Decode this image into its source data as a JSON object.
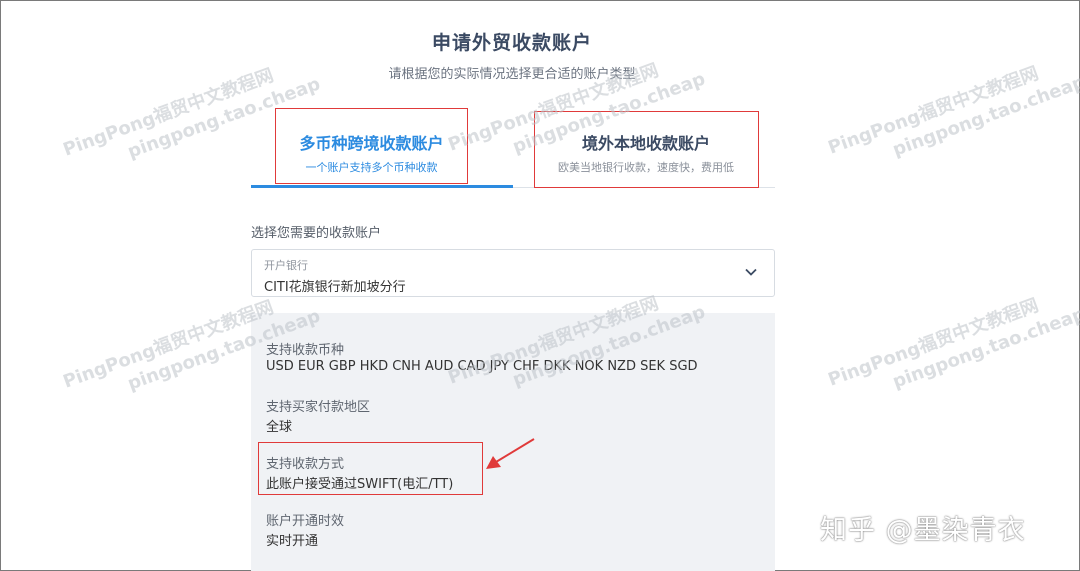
{
  "header": {
    "title": "申请外贸收款账户",
    "subtitle": "请根据您的实际情况选择更合适的账户类型"
  },
  "tabs": [
    {
      "title": "多币种跨境收款账户",
      "desc": "一个账户支持多个币种收款",
      "active": true
    },
    {
      "title": "境外本地收款账户",
      "desc": "欧美当地银行收款，速度快，费用低",
      "active": false
    }
  ],
  "form": {
    "section_label": "选择您需要的收款账户",
    "bank_select": {
      "label": "开户银行",
      "value": "CITI花旗银行新加坡分行",
      "icon": "chevron-down-icon"
    }
  },
  "details": [
    {
      "label": "支持收款币种",
      "value": "USD EUR GBP HKD CNH AUD CAD JPY CHF DKK NOK NZD SEK SGD"
    },
    {
      "label": "支持买家付款地区",
      "value": "全球"
    },
    {
      "label": "支持收款方式",
      "value": "此账户接受通过SWIFT(电汇/TT)"
    },
    {
      "label": "账户开通时效",
      "value": "实时开通"
    }
  ],
  "watermark": {
    "line1": "PingPong福贸中文教程网",
    "line2": "pingpong.tao.cheap"
  },
  "credit": "知乎 @墨染青衣",
  "colors": {
    "accent": "#2c8be0",
    "highlight_box": "#e03a3a",
    "panel_bg": "#f0f2f5"
  }
}
